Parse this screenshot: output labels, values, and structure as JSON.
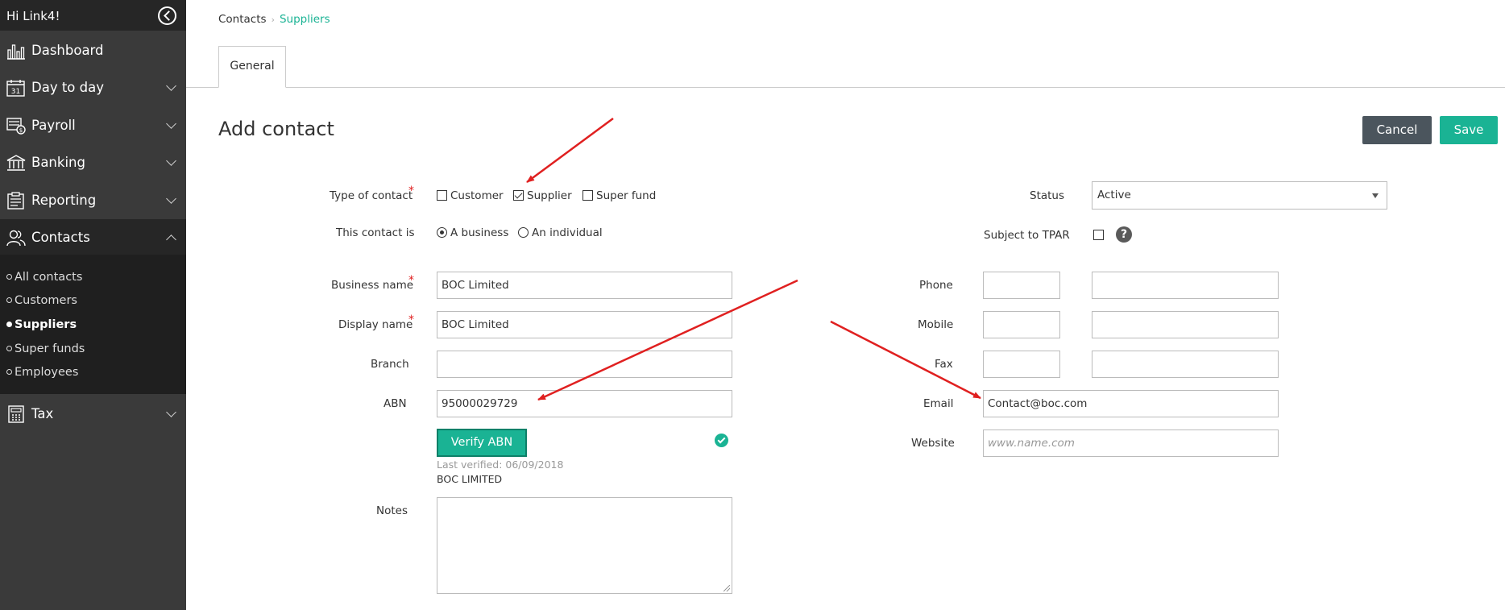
{
  "sidebar": {
    "greeting": "Hi Link4!",
    "items": [
      {
        "label": "Dashboard",
        "icon": "dashboard-chart-icon"
      },
      {
        "label": "Day to day",
        "icon": "calendar-icon",
        "calendar_day": "31"
      },
      {
        "label": "Payroll",
        "icon": "payroll-icon"
      },
      {
        "label": "Banking",
        "icon": "bank-icon"
      },
      {
        "label": "Reporting",
        "icon": "report-icon"
      },
      {
        "label": "Contacts",
        "icon": "contacts-icon"
      },
      {
        "label": "Tax",
        "icon": "calculator-icon"
      }
    ],
    "contacts_sub": [
      "All contacts",
      "Customers",
      "Suppliers",
      "Super funds",
      "Employees"
    ],
    "active_sub": "Suppliers"
  },
  "breadcrumb": {
    "parent": "Contacts",
    "current": "Suppliers"
  },
  "tabs": [
    {
      "label": "General"
    }
  ],
  "page": {
    "title": "Add contact",
    "cancel": "Cancel",
    "save": "Save"
  },
  "form": {
    "type_label": "Type of contact",
    "type_options": {
      "customer": "Customer",
      "supplier": "Supplier",
      "super_fund": "Super fund"
    },
    "type_checked": "Supplier",
    "contact_is_label": "This contact is",
    "contact_is_options": {
      "business": "A business",
      "individual": "An individual"
    },
    "contact_is_selected": "A business",
    "business_name_label": "Business name",
    "business_name_value": "BOC Limited",
    "display_name_label": "Display name",
    "display_name_value": "BOC Limited",
    "branch_label": "Branch",
    "abn_label": "ABN",
    "abn_value": "95000029729",
    "verify_button": "Verify ABN",
    "last_verified": "Last verified: 06/09/2018",
    "abn_entity": "BOC LIMITED",
    "notes_label": "Notes",
    "status_label": "Status",
    "status_value": "Active",
    "tpar_label": "Subject to TPAR",
    "help_symbol": "?",
    "phone_label": "Phone",
    "mobile_label": "Mobile",
    "fax_label": "Fax",
    "email_label": "Email",
    "email_value": "Contact@boc.com",
    "website_label": "Website",
    "website_placeholder": "www.name.com"
  },
  "colors": {
    "accent": "#1ab394",
    "sidebar": "#3a3a3a",
    "annotation": "#e02020"
  }
}
